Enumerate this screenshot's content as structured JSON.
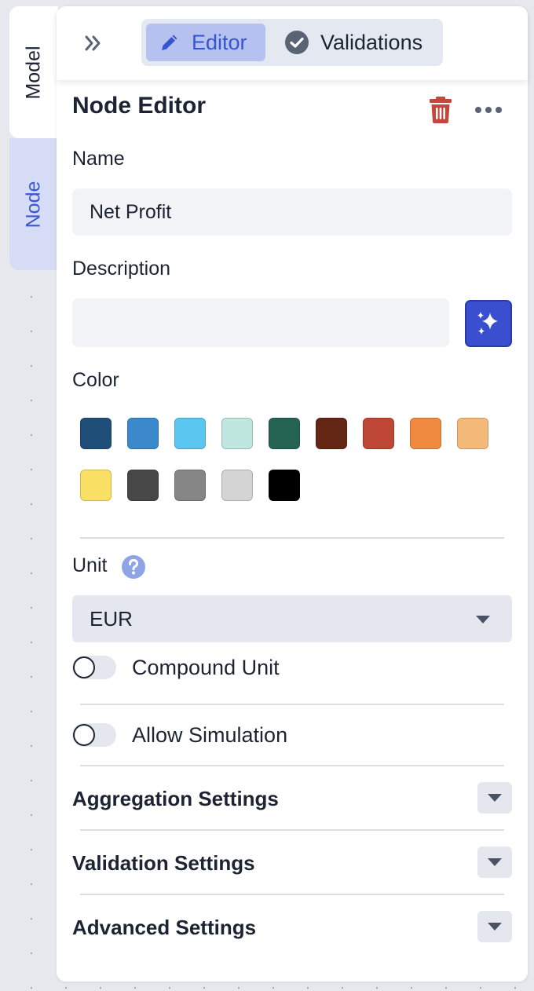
{
  "side_tabs": {
    "model": "Model",
    "node": "Node"
  },
  "topbar": {
    "collapse_icon": "double-chevron-right-icon",
    "tabs": [
      {
        "label": "Editor",
        "icon": "pencil-icon",
        "active": true
      },
      {
        "label": "Validations",
        "icon": "check-circle-icon",
        "active": false
      }
    ]
  },
  "header": {
    "title": "Node Editor",
    "delete_icon": "trash-icon",
    "more_icon": "more-horizontal-icon"
  },
  "form": {
    "name": {
      "label": "Name",
      "value": "Net Profit"
    },
    "description": {
      "label": "Description",
      "value": "",
      "ai_icon": "sparkles-icon"
    },
    "color": {
      "label": "Color",
      "swatches": [
        "#1f4e79",
        "#3b88cb",
        "#5bc6ef",
        "#bfe6df",
        "#246352",
        "#652715",
        "#bd4634",
        "#f08a41",
        "#f4ba7a",
        "#fbe066",
        "#474747",
        "#858585",
        "#d4d4d4",
        "#000000"
      ]
    },
    "unit": {
      "label": "Unit",
      "help_icon": "question-circle-icon",
      "selected": "EUR"
    },
    "compound_unit": {
      "label": "Compound Unit",
      "enabled": false
    },
    "allow_simulation": {
      "label": "Allow Simulation",
      "enabled": false
    }
  },
  "sections": [
    {
      "title": "Aggregation Settings"
    },
    {
      "title": "Validation Settings"
    },
    {
      "title": "Advanced Settings"
    }
  ],
  "colors": {
    "accent": "#3a56d1",
    "active_tab_bg": "#b5c1ef",
    "delete": "#c3473b",
    "help": "#8ea4e6"
  }
}
